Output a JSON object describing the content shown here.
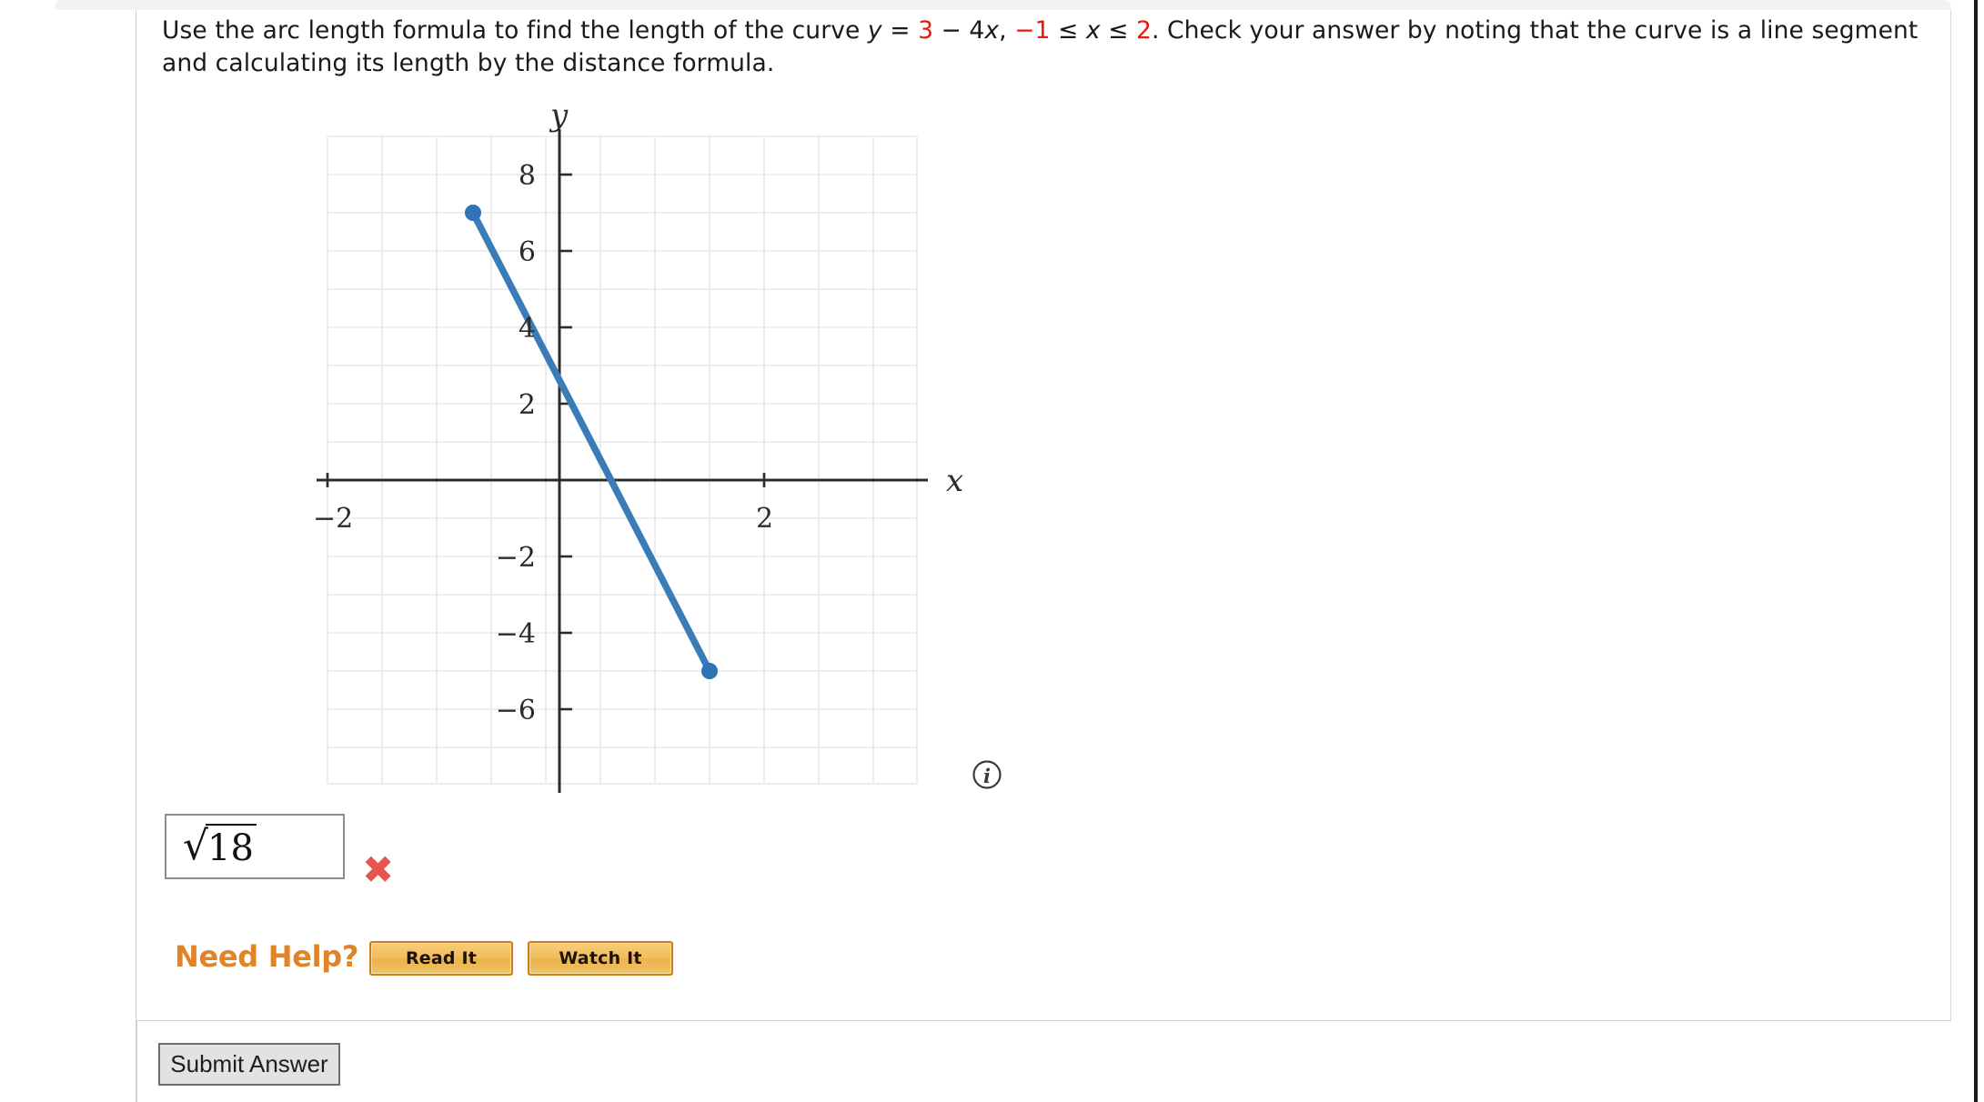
{
  "question": {
    "line1_part1": "Use the arc length formula to find the length of the curve ",
    "var_y": "y",
    "eq_sign": " = ",
    "const_3": "3",
    "minus_4x_pre": " − 4",
    "var_x_italic": "x",
    "comma": ", ",
    "lower_bound": "−1",
    "le1": " ≤ ",
    "var_x2": "x",
    "le2": " ≤ ",
    "upper_bound": "2",
    "line1_tail": ". Check your answer by noting that the curve is a line segment",
    "line2": "and calculating its length by the distance formula."
  },
  "chart_data": {
    "type": "line",
    "title": "",
    "xlabel": "x",
    "ylabel": "y",
    "grid": true,
    "legend": "none",
    "xlim": [
      -3,
      3.5
    ],
    "ylim": [
      -7,
      9
    ],
    "x_ticks": [
      -2,
      2
    ],
    "x_tick_labels": [
      "−2",
      "2"
    ],
    "y_ticks": [
      -6,
      -4,
      -2,
      2,
      4,
      6,
      8
    ],
    "y_tick_labels": [
      "−6",
      "−4",
      "−2",
      "2",
      "4",
      "6",
      "8"
    ],
    "series": [
      {
        "name": "y = 3 - 4x",
        "color": "#3a7cb8",
        "x": [
          -1,
          2
        ],
        "y": [
          7,
          -5
        ],
        "endpoints_marked": true,
        "marker_color": "#2f74b5"
      }
    ],
    "gridline_color": "#e8e8e8",
    "axis_color": "#2b2b2b"
  },
  "answer": {
    "radical_sign": "√",
    "radicand": "18",
    "status_icon": "wrong-x-icon",
    "status_glyph": "✖",
    "status_color": "#e4564f"
  },
  "need_help": {
    "label": "Need Help?",
    "buttons": [
      {
        "label": "Read It",
        "name": "read-it-button"
      },
      {
        "label": "Watch It",
        "name": "watch-it-button"
      }
    ]
  },
  "submit": {
    "label": "Submit Answer"
  },
  "info": {
    "glyph": "i",
    "name": "info-icon"
  },
  "colors": {
    "accent_red": "#e8180c",
    "help_orange": "#e08427",
    "curve_blue": "#3a7cb8",
    "wrong_red": "#e4564f"
  }
}
